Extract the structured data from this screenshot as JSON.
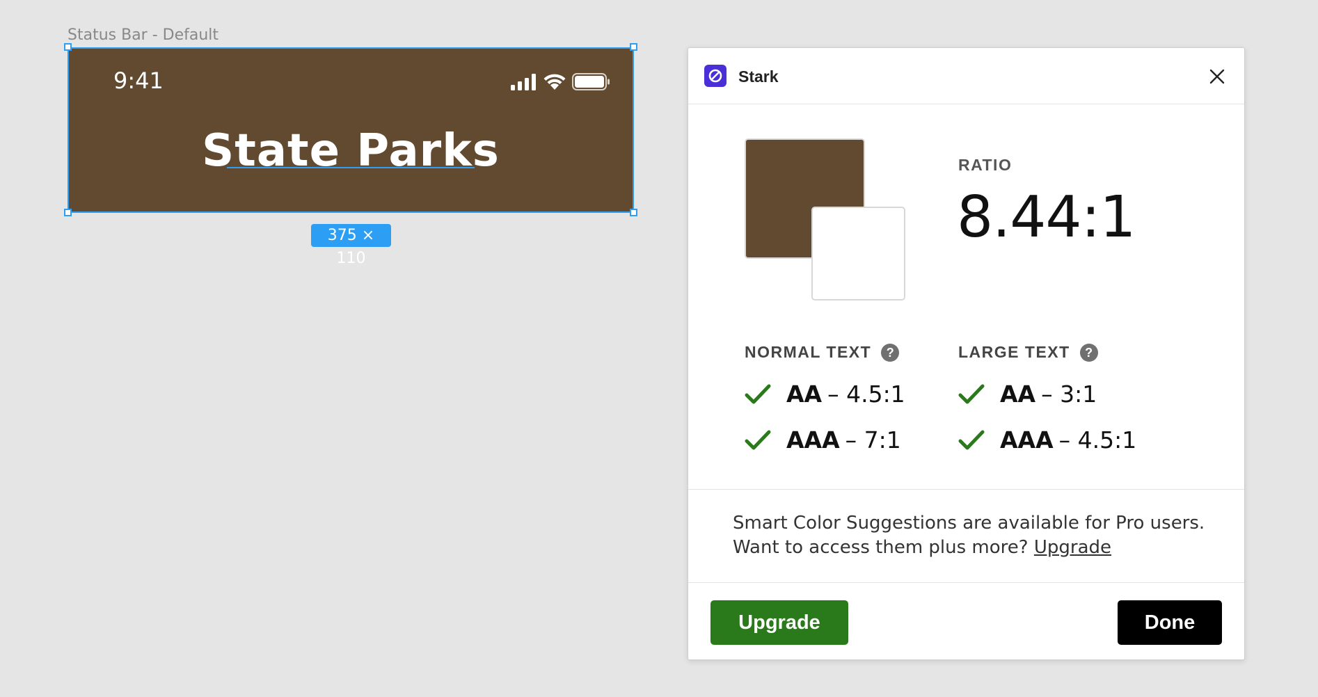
{
  "canvas": {
    "frame_label": "Status Bar - Default",
    "status_time": "9:41",
    "frame_title": "State Parks",
    "dimensions_badge": "375 × 110",
    "frame_color": "#614a2f",
    "selection_color": "#2c9ff5"
  },
  "stark": {
    "app_name": "Stark",
    "ratio_label": "RATIO",
    "ratio_value": "8.44:1",
    "foreground_color": "#614a2f",
    "background_color": "#ffffff",
    "normal_text": {
      "heading": "NORMAL TEXT",
      "help_icon": "?",
      "checks": [
        {
          "level": "AA",
          "requirement": "– 4.5:1",
          "passed": true
        },
        {
          "level": "AAA",
          "requirement": "– 7:1",
          "passed": true
        }
      ]
    },
    "large_text": {
      "heading": "LARGE TEXT",
      "help_icon": "?",
      "checks": [
        {
          "level": "AA",
          "requirement": "– 3:1",
          "passed": true
        },
        {
          "level": "AAA",
          "requirement": "– 4.5:1",
          "passed": true
        }
      ]
    },
    "promo": {
      "line1": "Smart Color Suggestions are available for Pro users.",
      "line2": "Want to access them plus more?",
      "link": "Upgrade"
    },
    "buttons": {
      "upgrade": "Upgrade",
      "done": "Done"
    },
    "accent_pass": "#2a7a1b",
    "logo_color": "#4b2fd6"
  }
}
